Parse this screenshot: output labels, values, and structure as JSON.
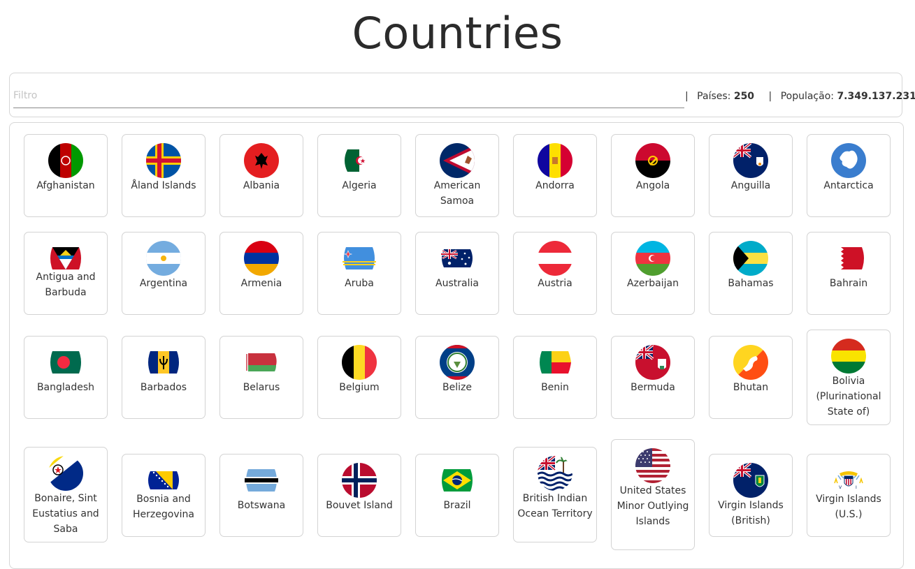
{
  "page": {
    "title": "Countries"
  },
  "filter": {
    "placeholder": "Filtro",
    "paises_label": "Países:",
    "paises_value": "250",
    "populacao_label": "População:",
    "populacao_value": "7.349.137.231",
    "separator": "|"
  },
  "countries": [
    {
      "name": "Afghanistan"
    },
    {
      "name": "Åland Islands"
    },
    {
      "name": "Albania"
    },
    {
      "name": "Algeria"
    },
    {
      "name": "American Samoa"
    },
    {
      "name": "Andorra"
    },
    {
      "name": "Angola"
    },
    {
      "name": "Anguilla"
    },
    {
      "name": "Antarctica"
    },
    {
      "name": "Antigua and Barbuda"
    },
    {
      "name": "Argentina"
    },
    {
      "name": "Armenia"
    },
    {
      "name": "Aruba"
    },
    {
      "name": "Australia"
    },
    {
      "name": "Austria"
    },
    {
      "name": "Azerbaijan"
    },
    {
      "name": "Bahamas"
    },
    {
      "name": "Bahrain"
    },
    {
      "name": "Bangladesh"
    },
    {
      "name": "Barbados"
    },
    {
      "name": "Belarus"
    },
    {
      "name": "Belgium"
    },
    {
      "name": "Belize"
    },
    {
      "name": "Benin"
    },
    {
      "name": "Bermuda"
    },
    {
      "name": "Bhutan"
    },
    {
      "name": "Bolivia (Plurinational State of)"
    },
    {
      "name": "Bonaire, Sint Eustatius and Saba"
    },
    {
      "name": "Bosnia and Herzegovina"
    },
    {
      "name": "Botswana"
    },
    {
      "name": "Bouvet Island"
    },
    {
      "name": "Brazil"
    },
    {
      "name": "British Indian Ocean Territory"
    },
    {
      "name": "United States Minor Outlying Islands"
    },
    {
      "name": "Virgin Islands (British)"
    },
    {
      "name": "Virgin Islands (U.S.)"
    }
  ],
  "flag_icons": [
    "afghanistan-flag-icon",
    "aland-islands-flag-icon",
    "albania-flag-icon",
    "algeria-flag-icon",
    "american-samoa-flag-icon",
    "andorra-flag-icon",
    "angola-flag-icon",
    "anguilla-flag-icon",
    "antarctica-flag-icon",
    "antigua-and-barbuda-flag-icon",
    "argentina-flag-icon",
    "armenia-flag-icon",
    "aruba-flag-icon",
    "australia-flag-icon",
    "austria-flag-icon",
    "azerbaijan-flag-icon",
    "bahamas-flag-icon",
    "bahrain-flag-icon",
    "bangladesh-flag-icon",
    "barbados-flag-icon",
    "belarus-flag-icon",
    "belgium-flag-icon",
    "belize-flag-icon",
    "benin-flag-icon",
    "bermuda-flag-icon",
    "bhutan-flag-icon",
    "bolivia-flag-icon",
    "bonaire-flag-icon",
    "bosnia-flag-icon",
    "botswana-flag-icon",
    "bouvet-island-flag-icon",
    "brazil-flag-icon",
    "biot-flag-icon",
    "us-minor-islands-flag-icon",
    "virgin-islands-british-flag-icon",
    "virgin-islands-us-flag-icon"
  ]
}
